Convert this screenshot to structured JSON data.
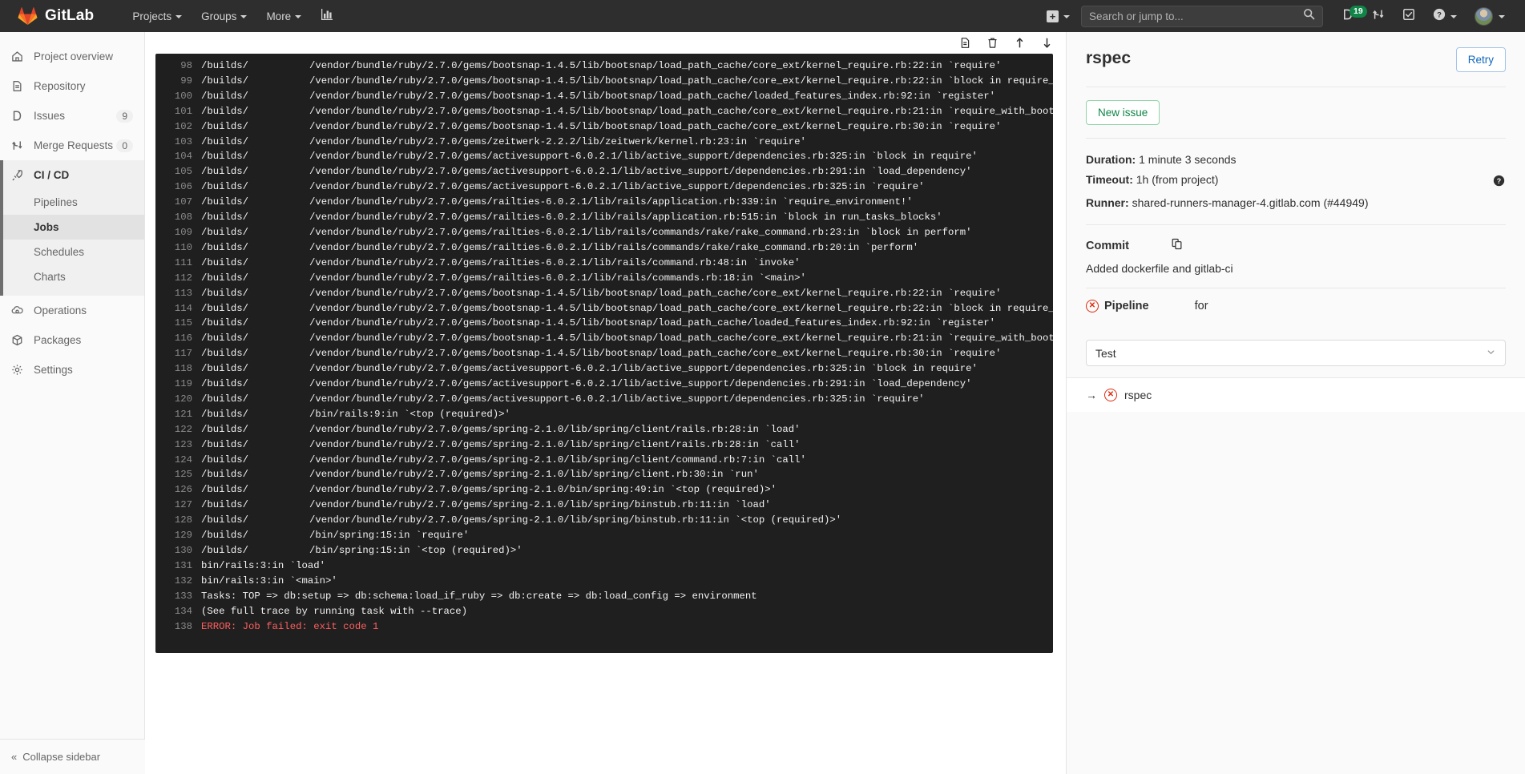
{
  "topnav": {
    "brand": "GitLab",
    "links": [
      {
        "label": "Projects",
        "name": "nav-projects"
      },
      {
        "label": "Groups",
        "name": "nav-groups"
      },
      {
        "label": "More",
        "name": "nav-more"
      }
    ],
    "analytics_icon": "chart-bar-icon",
    "create_icon": "plus-square-icon",
    "search": {
      "placeholder": "Search or jump to...",
      "value": "",
      "icon": "search-icon"
    },
    "issues_icon": "issues-icon",
    "issues_count": "19",
    "merge_requests_icon": "merge-request-icon",
    "todos_icon": "todo-checkmark-icon",
    "help_icon": "question-circle-icon",
    "avatar_icon": "user-avatar"
  },
  "sidebar": {
    "items": [
      {
        "label": "Project overview",
        "icon": "home-icon",
        "badge": ""
      },
      {
        "label": "Repository",
        "icon": "document-icon",
        "badge": ""
      },
      {
        "label": "Issues",
        "icon": "issues-icon",
        "badge": "9"
      },
      {
        "label": "Merge Requests",
        "icon": "merge-request-icon",
        "badge": "0"
      }
    ],
    "cicd": {
      "label": "CI / CD",
      "icon": "rocket-icon",
      "sub": [
        {
          "label": "Pipelines"
        },
        {
          "label": "Jobs"
        },
        {
          "label": "Schedules"
        },
        {
          "label": "Charts"
        }
      ],
      "current_sub": "Jobs"
    },
    "items_bottom": [
      {
        "label": "Operations",
        "icon": "cloud-gear-icon",
        "badge": ""
      },
      {
        "label": "Packages",
        "icon": "package-icon",
        "badge": ""
      },
      {
        "label": "Settings",
        "icon": "gear-icon",
        "badge": ""
      }
    ],
    "collapse_label": "Collapse sidebar",
    "collapse_icon": "double-chevron-left-icon"
  },
  "log_toolbar": {
    "raw_icon": "raw-file-icon",
    "erase_icon": "trash-icon",
    "scroll_top_icon": "scroll-to-top-icon",
    "scroll_bottom_icon": "scroll-to-bottom-icon"
  },
  "log": {
    "lines": [
      {
        "n": "98",
        "prefix": "/builds/",
        "text": "/vendor/bundle/ruby/2.7.0/gems/bootsnap-1.4.5/lib/bootsnap/load_path_cache/core_ext/kernel_require.rb:22:in `require'"
      },
      {
        "n": "99",
        "prefix": "/builds/",
        "text": "/vendor/bundle/ruby/2.7.0/gems/bootsnap-1.4.5/lib/bootsnap/load_path_cache/core_ext/kernel_require.rb:22:in `block in require_with_bootsnap_lfi'"
      },
      {
        "n": "100",
        "prefix": "/builds/",
        "text": "/vendor/bundle/ruby/2.7.0/gems/bootsnap-1.4.5/lib/bootsnap/load_path_cache/loaded_features_index.rb:92:in `register'"
      },
      {
        "n": "101",
        "prefix": "/builds/",
        "text": "/vendor/bundle/ruby/2.7.0/gems/bootsnap-1.4.5/lib/bootsnap/load_path_cache/core_ext/kernel_require.rb:21:in `require_with_bootsnap_lfi'"
      },
      {
        "n": "102",
        "prefix": "/builds/",
        "text": "/vendor/bundle/ruby/2.7.0/gems/bootsnap-1.4.5/lib/bootsnap/load_path_cache/core_ext/kernel_require.rb:30:in `require'"
      },
      {
        "n": "103",
        "prefix": "/builds/",
        "text": "/vendor/bundle/ruby/2.7.0/gems/zeitwerk-2.2.2/lib/zeitwerk/kernel.rb:23:in `require'"
      },
      {
        "n": "104",
        "prefix": "/builds/",
        "text": "/vendor/bundle/ruby/2.7.0/gems/activesupport-6.0.2.1/lib/active_support/dependencies.rb:325:in `block in require'"
      },
      {
        "n": "105",
        "prefix": "/builds/",
        "text": "/vendor/bundle/ruby/2.7.0/gems/activesupport-6.0.2.1/lib/active_support/dependencies.rb:291:in `load_dependency'"
      },
      {
        "n": "106",
        "prefix": "/builds/",
        "text": "/vendor/bundle/ruby/2.7.0/gems/activesupport-6.0.2.1/lib/active_support/dependencies.rb:325:in `require'"
      },
      {
        "n": "107",
        "prefix": "/builds/",
        "text": "/vendor/bundle/ruby/2.7.0/gems/railties-6.0.2.1/lib/rails/application.rb:339:in `require_environment!'"
      },
      {
        "n": "108",
        "prefix": "/builds/",
        "text": "/vendor/bundle/ruby/2.7.0/gems/railties-6.0.2.1/lib/rails/application.rb:515:in `block in run_tasks_blocks'"
      },
      {
        "n": "109",
        "prefix": "/builds/",
        "text": "/vendor/bundle/ruby/2.7.0/gems/railties-6.0.2.1/lib/rails/commands/rake/rake_command.rb:23:in `block in perform'"
      },
      {
        "n": "110",
        "prefix": "/builds/",
        "text": "/vendor/bundle/ruby/2.7.0/gems/railties-6.0.2.1/lib/rails/commands/rake/rake_command.rb:20:in `perform'"
      },
      {
        "n": "111",
        "prefix": "/builds/",
        "text": "/vendor/bundle/ruby/2.7.0/gems/railties-6.0.2.1/lib/rails/command.rb:48:in `invoke'"
      },
      {
        "n": "112",
        "prefix": "/builds/",
        "text": "/vendor/bundle/ruby/2.7.0/gems/railties-6.0.2.1/lib/rails/commands.rb:18:in `<main>'"
      },
      {
        "n": "113",
        "prefix": "/builds/",
        "text": "/vendor/bundle/ruby/2.7.0/gems/bootsnap-1.4.5/lib/bootsnap/load_path_cache/core_ext/kernel_require.rb:22:in `require'"
      },
      {
        "n": "114",
        "prefix": "/builds/",
        "text": "/vendor/bundle/ruby/2.7.0/gems/bootsnap-1.4.5/lib/bootsnap/load_path_cache/core_ext/kernel_require.rb:22:in `block in require_with_bootsnap_lfi'"
      },
      {
        "n": "115",
        "prefix": "/builds/",
        "text": "/vendor/bundle/ruby/2.7.0/gems/bootsnap-1.4.5/lib/bootsnap/load_path_cache/loaded_features_index.rb:92:in `register'"
      },
      {
        "n": "116",
        "prefix": "/builds/",
        "text": "/vendor/bundle/ruby/2.7.0/gems/bootsnap-1.4.5/lib/bootsnap/load_path_cache/core_ext/kernel_require.rb:21:in `require_with_bootsnap_lfi'"
      },
      {
        "n": "117",
        "prefix": "/builds/",
        "text": "/vendor/bundle/ruby/2.7.0/gems/bootsnap-1.4.5/lib/bootsnap/load_path_cache/core_ext/kernel_require.rb:30:in `require'"
      },
      {
        "n": "118",
        "prefix": "/builds/",
        "text": "/vendor/bundle/ruby/2.7.0/gems/activesupport-6.0.2.1/lib/active_support/dependencies.rb:325:in `block in require'"
      },
      {
        "n": "119",
        "prefix": "/builds/",
        "text": "/vendor/bundle/ruby/2.7.0/gems/activesupport-6.0.2.1/lib/active_support/dependencies.rb:291:in `load_dependency'"
      },
      {
        "n": "120",
        "prefix": "/builds/",
        "text": "/vendor/bundle/ruby/2.7.0/gems/activesupport-6.0.2.1/lib/active_support/dependencies.rb:325:in `require'"
      },
      {
        "n": "121",
        "prefix": "/builds/",
        "text": "/bin/rails:9:in `<top (required)>'"
      },
      {
        "n": "122",
        "prefix": "/builds/",
        "text": "/vendor/bundle/ruby/2.7.0/gems/spring-2.1.0/lib/spring/client/rails.rb:28:in `load'"
      },
      {
        "n": "123",
        "prefix": "/builds/",
        "text": "/vendor/bundle/ruby/2.7.0/gems/spring-2.1.0/lib/spring/client/rails.rb:28:in `call'"
      },
      {
        "n": "124",
        "prefix": "/builds/",
        "text": "/vendor/bundle/ruby/2.7.0/gems/spring-2.1.0/lib/spring/client/command.rb:7:in `call'"
      },
      {
        "n": "125",
        "prefix": "/builds/",
        "text": "/vendor/bundle/ruby/2.7.0/gems/spring-2.1.0/lib/spring/client.rb:30:in `run'"
      },
      {
        "n": "126",
        "prefix": "/builds/",
        "text": "/vendor/bundle/ruby/2.7.0/gems/spring-2.1.0/bin/spring:49:in `<top (required)>'"
      },
      {
        "n": "127",
        "prefix": "/builds/",
        "text": "/vendor/bundle/ruby/2.7.0/gems/spring-2.1.0/lib/spring/binstub.rb:11:in `load'"
      },
      {
        "n": "128",
        "prefix": "/builds/",
        "text": "/vendor/bundle/ruby/2.7.0/gems/spring-2.1.0/lib/spring/binstub.rb:11:in `<top (required)>'"
      },
      {
        "n": "129",
        "prefix": "/builds/",
        "text": "/bin/spring:15:in `require'"
      },
      {
        "n": "130",
        "prefix": "/builds/",
        "text": "/bin/spring:15:in `<top (required)>'"
      },
      {
        "n": "131",
        "prefix": "",
        "text": "bin/rails:3:in `load'"
      },
      {
        "n": "132",
        "prefix": "",
        "text": "bin/rails:3:in `<main>'"
      },
      {
        "n": "133",
        "prefix": "",
        "text": "Tasks: TOP => db:setup => db:schema:load_if_ruby => db:create => db:load_config => environment"
      },
      {
        "n": "134",
        "prefix": "",
        "text": "(See full trace by running task with --trace)"
      },
      {
        "n": "138",
        "prefix": "",
        "text": "ERROR: Job failed: exit code 1",
        "error": true
      }
    ]
  },
  "job": {
    "title": "rspec",
    "retry_label": "Retry",
    "new_issue_label": "New issue",
    "duration_label": "Duration:",
    "duration_value": "1 minute 3 seconds",
    "timeout_label": "Timeout:",
    "timeout_value": "1h (from project)",
    "runner_label": "Runner:",
    "runner_value": "shared-runners-manager-4.gitlab.com (#44949)",
    "commit_label": "Commit",
    "commit_copy_icon": "copy-icon",
    "commit_message": "Added dockerfile and gitlab-ci",
    "pipeline_label": "Pipeline",
    "pipeline_for": "for",
    "pipeline_status_icon": "status-failed-icon",
    "stage_selected": "Test",
    "stage_caret_icon": "chevron-down-icon",
    "jobs": [
      {
        "name": "rspec",
        "status_icon": "status-failed-icon",
        "arrow_icon": "arrow-right-icon"
      }
    ]
  },
  "colors": {
    "nav_bg": "#2e2e2e",
    "failed_red": "#dd2b0e",
    "link_blue": "#1068bf",
    "success_green": "#108548",
    "log_bg": "#1f1f1f",
    "error_text": "#ff5f5f"
  }
}
